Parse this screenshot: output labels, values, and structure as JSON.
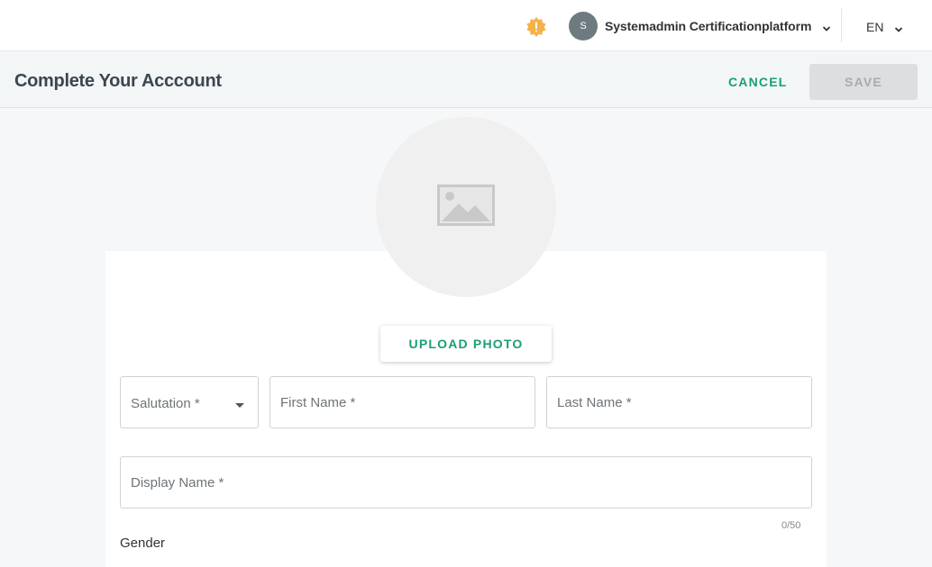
{
  "topbar": {
    "alert_icon_color": "#f4b24a",
    "user": {
      "avatar_initial": "S",
      "name": "Systemadmin Certificationplatform",
      "avatar_color": "#6d7a80"
    },
    "language": "EN"
  },
  "header": {
    "title": "Complete Your Acccount",
    "cancel_label": "CANCEL",
    "save_label": "SAVE",
    "accent_color": "#1a9e77"
  },
  "form": {
    "upload_label": "UPLOAD PHOTO",
    "salutation_placeholder": "Salutation *",
    "first_name_placeholder": "First Name *",
    "last_name_placeholder": "Last Name *",
    "display_name_placeholder": "Display Name *",
    "display_name_counter": "0/50",
    "gender_label": "Gender"
  }
}
